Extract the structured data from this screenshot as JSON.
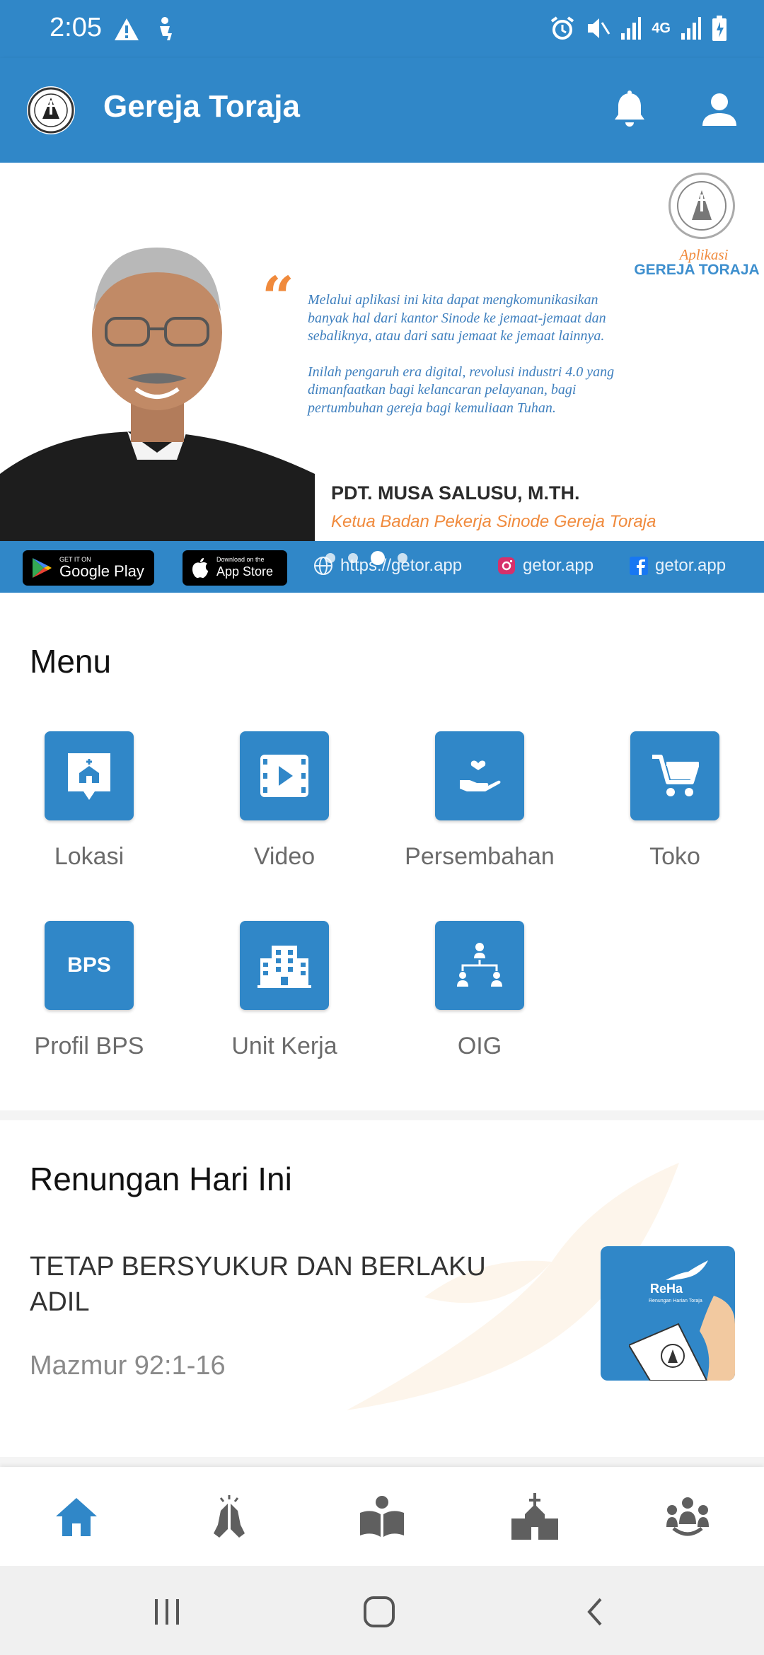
{
  "status_bar": {
    "time": "2:05",
    "network_label": "4G"
  },
  "app_bar": {
    "title": "Gereja Toraja"
  },
  "banner": {
    "app_label": "Aplikasi",
    "app_name": "GEREJA TORAJA",
    "quote_paragraph_1": "Melalui aplikasi ini kita dapat mengkomunikasikan banyak hal dari kantor Sinode ke jemaat-jemaat dan sebaliknya, atau dari satu jemaat ke jemaat lainnya.",
    "quote_paragraph_2": "Inilah pengaruh era digital, revolusi industri 4.0 yang dimanfaatkan bagi kelancaran pelayanan, bagi pertumbuhan gereja bagi kemuliaan Tuhan.",
    "name": "PDT. MUSA SALUSU, M.TH.",
    "role": "Ketua Badan Pekerja Sinode Gereja Toraja",
    "google_play_small": "GET IT ON",
    "google_play_big": "Google Play",
    "app_store_small": "Download on the",
    "app_store_big": "App Store",
    "website": "https://getor.app",
    "instagram": "getor.app",
    "facebook": "getor.app",
    "carousel": {
      "count": 4,
      "active_index": 2
    }
  },
  "menu": {
    "heading": "Menu",
    "items": [
      {
        "label": "Lokasi",
        "icon": "church-location-icon"
      },
      {
        "label": "Video",
        "icon": "video-icon"
      },
      {
        "label": "Persembahan",
        "icon": "offering-hand-heart-icon"
      },
      {
        "label": "Toko",
        "icon": "cart-icon"
      },
      {
        "label": "Profil BPS",
        "icon": "bps-icon",
        "tile_text": "BPS"
      },
      {
        "label": "Unit Kerja",
        "icon": "building-icon"
      },
      {
        "label": "OIG",
        "icon": "org-chart-icon"
      }
    ]
  },
  "renungan": {
    "heading": "Renungan Hari Ini",
    "title": "TETAP BERSYUKUR DAN BERLAKU ADIL",
    "verse": "Mazmur 92:1-16",
    "thumb_brand": "ReHa",
    "thumb_subtitle": "Renungan Harian Toraja"
  },
  "bottom_nav": {
    "items": [
      {
        "icon": "home-icon",
        "active": true
      },
      {
        "icon": "praying-hands-icon",
        "active": false
      },
      {
        "icon": "reading-person-icon",
        "active": false
      },
      {
        "icon": "church-icon",
        "active": false
      },
      {
        "icon": "community-icon",
        "active": false
      }
    ]
  },
  "colors": {
    "primary": "#3087c8",
    "accent_orange": "#f08a3c",
    "nav_inactive": "#5f5f5f",
    "label_gray": "#6b6b6b"
  }
}
